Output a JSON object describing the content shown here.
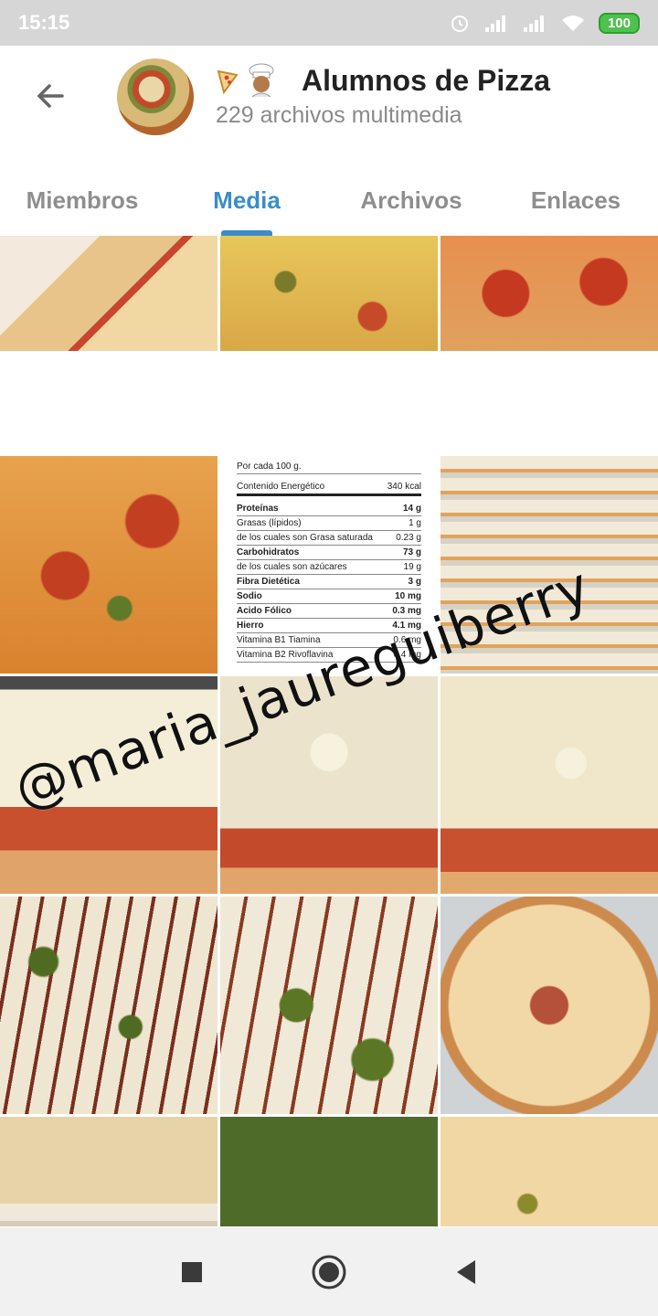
{
  "status": {
    "time": "15:15",
    "battery": "100"
  },
  "header": {
    "title": "Alumnos de Pizza",
    "subtitle": "229 archivos multimedia",
    "emoji": "🍕👨🏽‍🍳"
  },
  "tabs": [
    {
      "label": "Miembros"
    },
    {
      "label": "Media"
    },
    {
      "label": "Archivos"
    },
    {
      "label": "Enlaces"
    }
  ],
  "active_tab": "Media",
  "nutrition": {
    "heading": "Por cada 100 g.",
    "energy_label": "Contenido Energético",
    "energy_value": "340 kcal",
    "rows": [
      {
        "label": "Proteínas",
        "value": "14 g"
      },
      {
        "label": "Grasas (lípidos)",
        "value": "1 g"
      },
      {
        "label": "de los cuales son Grasa saturada",
        "value": "0.23 g"
      },
      {
        "label": "Carbohidratos",
        "value": "73 g"
      },
      {
        "label": "de los cuales son azúcares",
        "value": "19 g"
      },
      {
        "label": "Fibra Dietética",
        "value": "3 g"
      },
      {
        "label": "Sodio",
        "value": "10 mg"
      },
      {
        "label": "Acido Fólico",
        "value": "0.3 mg"
      },
      {
        "label": "Hierro",
        "value": "4.1 mg"
      },
      {
        "label": "Vitamina B1 Tiamina",
        "value": "0.6 mg"
      },
      {
        "label": "Vitamina B2 Rivoflavina",
        "value": "0.4 mg"
      }
    ]
  },
  "watermark": "@maria_jaureguiberry",
  "colors": {
    "accent": "#3a8dc9",
    "status_bar": "#d6d6d6",
    "battery": "#4fc14f"
  }
}
